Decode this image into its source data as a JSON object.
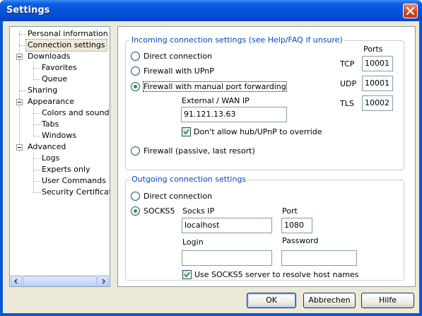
{
  "window": {
    "title": "Settings"
  },
  "tree": {
    "items": [
      {
        "label": "Personal information"
      },
      {
        "label": "Connection settings"
      },
      {
        "label": "Downloads"
      },
      {
        "label": "Favorites"
      },
      {
        "label": "Queue"
      },
      {
        "label": "Sharing"
      },
      {
        "label": "Appearance"
      },
      {
        "label": "Colors and sounds"
      },
      {
        "label": "Tabs"
      },
      {
        "label": "Windows"
      },
      {
        "label": "Advanced"
      },
      {
        "label": "Logs"
      },
      {
        "label": "Experts only"
      },
      {
        "label": "User Commands"
      },
      {
        "label": "Security Certificates"
      }
    ],
    "selected": "Connection settings"
  },
  "incoming": {
    "title": "Incoming connection settings (see Help/FAQ if unsure)",
    "direct_label": "Direct connection",
    "upnp_label": "Firewall with UPnP",
    "manual_label": "Firewall with manual port forwarding",
    "passive_label": "Firewall (passive, last resort)",
    "selected": "manual",
    "ext_ip_label": "External / WAN IP",
    "ext_ip_value": "91.121.13.63",
    "no_override_label": "Don't allow hub/UPnP to override",
    "no_override_checked": true,
    "ports_label": "Ports",
    "tcp_label": "TCP",
    "tcp_value": "10001",
    "udp_label": "UDP",
    "udp_value": "10001",
    "tls_label": "TLS",
    "tls_value": "10002"
  },
  "outgoing": {
    "title": "Outgoing connection settings",
    "direct_label": "Direct connection",
    "socks_label": "SOCKS5",
    "selected": "socks5",
    "socks_ip_label": "Socks IP",
    "socks_ip_value": "localhost",
    "port_label": "Port",
    "port_value": "1080",
    "login_label": "Login",
    "login_value": "",
    "password_label": "Password",
    "password_value": "",
    "resolve_label": "Use SOCKS5 server to resolve host names",
    "resolve_checked": true
  },
  "buttons": {
    "ok": "OK",
    "cancel": "Abbrechen",
    "help": "Hilfe"
  },
  "colors": {
    "titlebar": "#0551d8",
    "client": "#ece9d8",
    "group_title": "#0046d5",
    "radio_dot": "#21a121",
    "check_mark": "#21a121"
  }
}
